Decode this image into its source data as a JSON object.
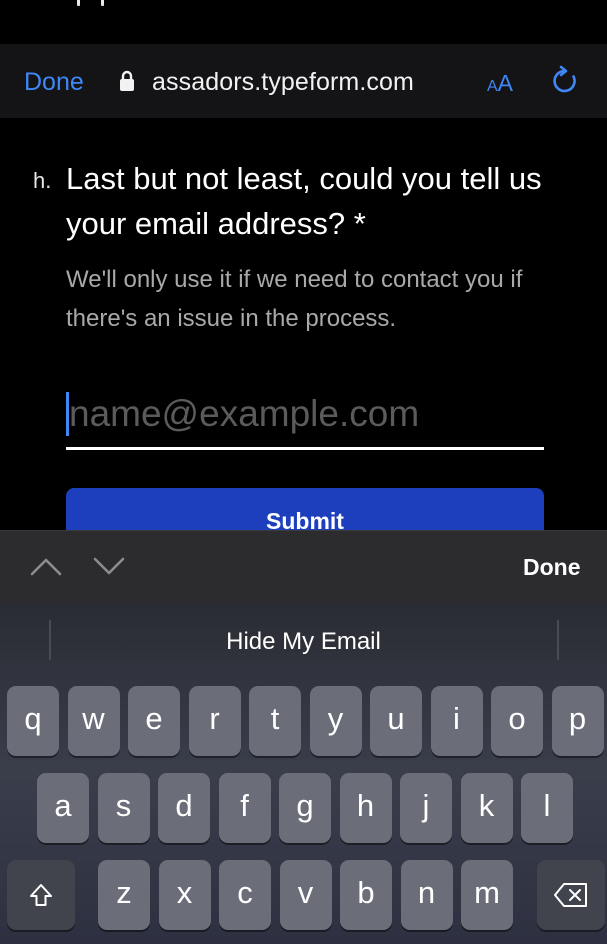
{
  "browser": {
    "done_label": "Done",
    "url": "assadors.typeform.com",
    "text_size_label_small": "A",
    "text_size_label_large": "A"
  },
  "form": {
    "question_number": "h.",
    "question_title": "Last but not least, could you tell us your email address? *",
    "question_description": "We'll only use it if we need to contact you if there's an issue in the process.",
    "email_placeholder": "name@example.com",
    "submit_label": "Submit"
  },
  "accessory": {
    "done_label": "Done"
  },
  "keyboard": {
    "suggestion": "Hide My Email",
    "row1": [
      "q",
      "w",
      "e",
      "r",
      "t",
      "y",
      "u",
      "i",
      "o",
      "p"
    ],
    "row2": [
      "a",
      "s",
      "d",
      "f",
      "g",
      "h",
      "j",
      "k",
      "l"
    ],
    "row3": [
      "z",
      "x",
      "c",
      "v",
      "b",
      "n",
      "m"
    ]
  },
  "colors": {
    "accent": "#3f87f5",
    "submit_bg": "#1d3fbe",
    "key_bg": "#6b6e79",
    "function_key_bg": "#41444d"
  },
  "icons": [
    "lock-icon",
    "reload-icon",
    "chevron-up-icon",
    "chevron-down-icon",
    "shift-icon",
    "delete-icon"
  ]
}
